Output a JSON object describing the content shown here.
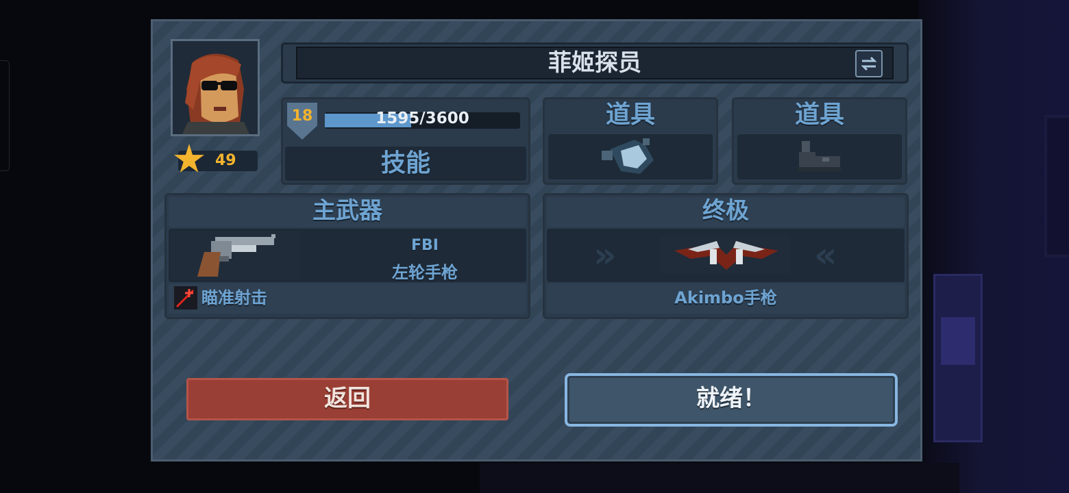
{
  "character": {
    "name": "菲姬探员",
    "stars": "49",
    "level": "18",
    "xp_text": "1595/3600",
    "xp_fraction": 0.443
  },
  "labels": {
    "skill": "技能",
    "item1": "道具",
    "item2": "道具",
    "primary_weapon": "主武器",
    "ultimate": "终极"
  },
  "primary_weapon": {
    "brand": "FBI",
    "name": "左轮手枪",
    "perk": "瞄准射击"
  },
  "ultimate": {
    "name": "Akimbo手枪"
  },
  "buttons": {
    "back": "返回",
    "ready": "就绪！"
  },
  "icons": {
    "swap": "swap-arrows-icon",
    "star": "star-icon",
    "item1": "grenade-icon",
    "item2": "boot-icon",
    "weapon": "revolver-icon",
    "ultimate": "dual-pistols-icon",
    "perk": "aim-shot-icon"
  },
  "colors": {
    "accent": "#5d97cc",
    "gold": "#f2b32e",
    "back_button": "#9a3f35",
    "ready_border": "#88b7e2"
  }
}
